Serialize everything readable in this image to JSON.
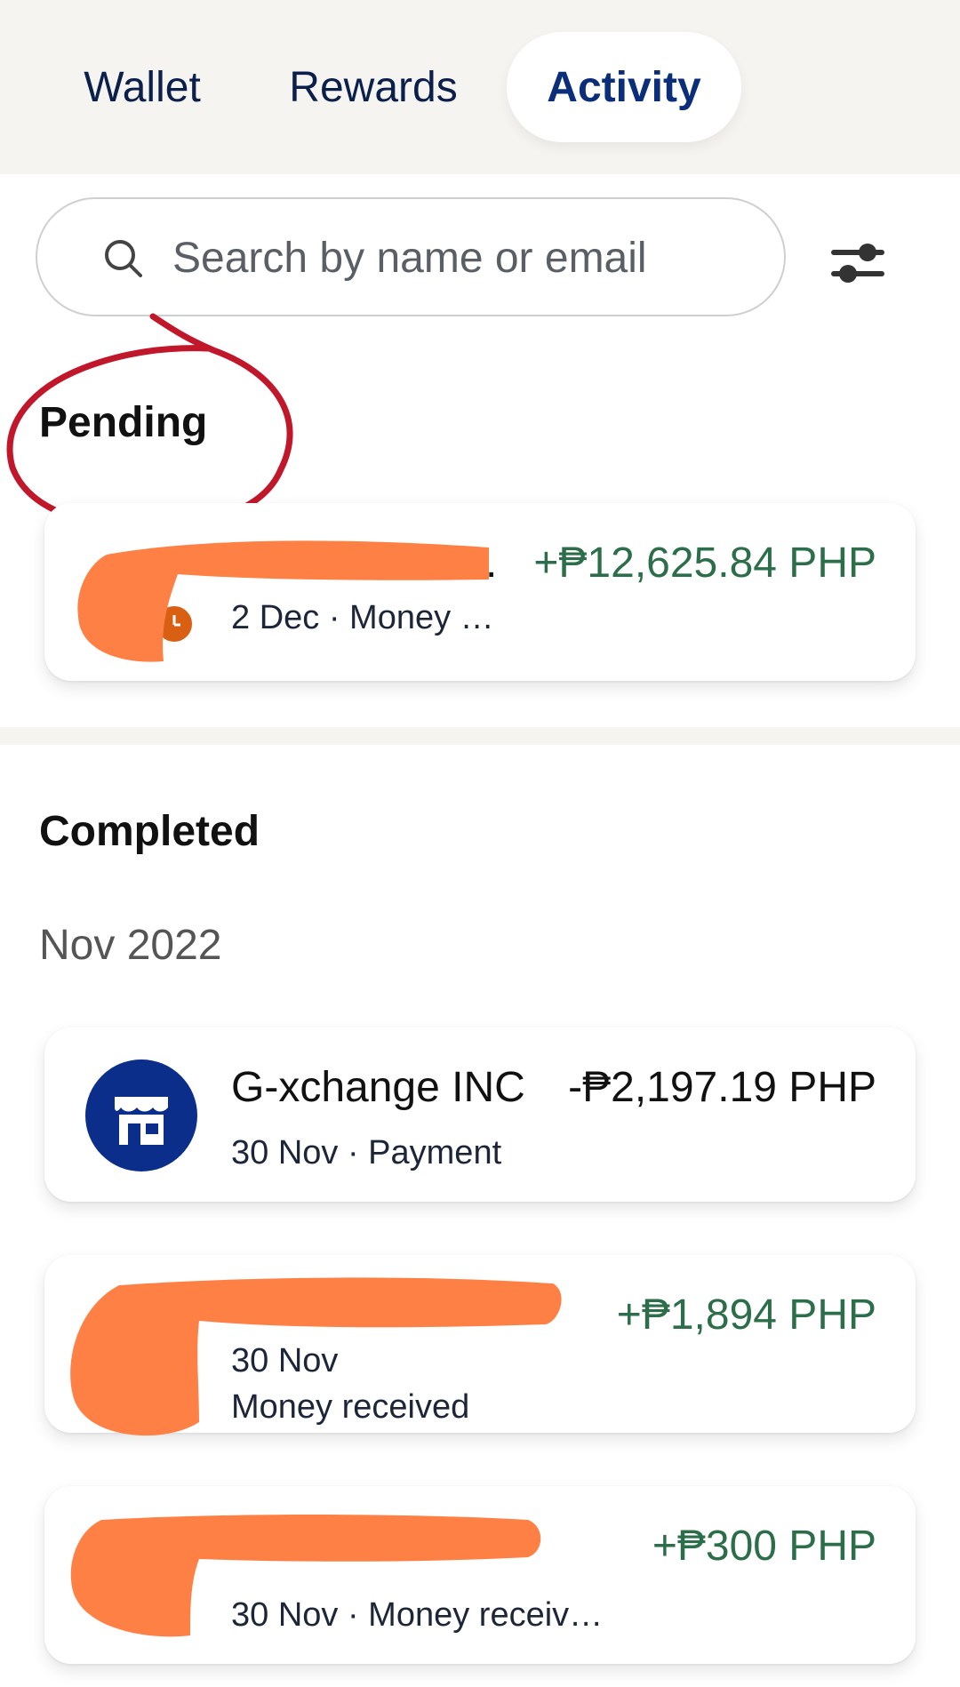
{
  "tabs": [
    {
      "label": "Wallet",
      "active": false
    },
    {
      "label": "Rewards",
      "active": false
    },
    {
      "label": "Activity",
      "active": true
    }
  ],
  "search": {
    "placeholder": "Search by name or email"
  },
  "pending": {
    "title": "Pending",
    "items": [
      {
        "name": ".",
        "subtitle": "2 Dec · Money …",
        "amount": "+₱12,625.84 PHP",
        "direction": "in"
      }
    ]
  },
  "completed": {
    "title": "Completed",
    "month": "Nov 2022",
    "items": [
      {
        "name": "G-xchange INC",
        "subtitle": "30 Nov · Payment",
        "amount": "-₱2,197.19 PHP",
        "direction": "out",
        "icon": "store-icon"
      },
      {
        "date": "30 Nov",
        "subtitle": "Money received",
        "amount": "+₱1,894 PHP",
        "direction": "in"
      },
      {
        "subtitle": "30 Nov · Money receiv…",
        "amount": "+₱300 PHP",
        "direction": "in"
      }
    ]
  },
  "colors": {
    "brand_blue": "#0a2e7a",
    "positive_green": "#2c6e49",
    "annotation_red": "#c0182a",
    "redaction_orange": "#ff8045",
    "pending_clock": "#d95f13"
  }
}
